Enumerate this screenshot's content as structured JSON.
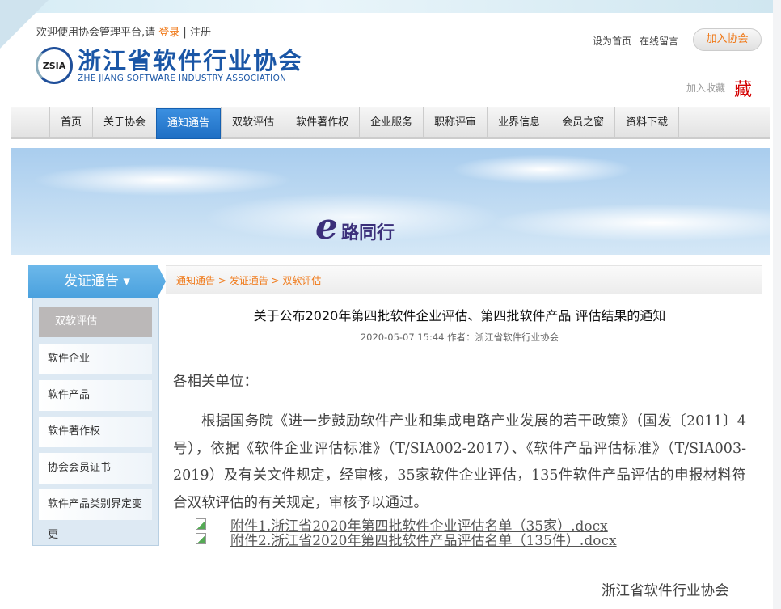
{
  "header": {
    "welcome": "欢迎使用协会管理平台,请 ",
    "login": "登录",
    "sep": " | ",
    "register": "注册",
    "logo_badge": "ZSIA",
    "logo_cn": "浙江省软件行业协会",
    "logo_en": "ZHE JIANG SOFTWARE INDUSTRY ASSOCIATION",
    "set_home": "设为首页",
    "message": "在线留言",
    "join": "加入协会",
    "favorite": "加入收藏",
    "favorite_icon": "藏"
  },
  "nav": [
    "首页",
    "关于协会",
    "通知通告",
    "双软评估",
    "软件著作权",
    "企业服务",
    "职称评审",
    "业界信息",
    "会员之窗",
    "资料下载"
  ],
  "banner": {
    "e": "e",
    "text": "路同行"
  },
  "sidebar": {
    "title": "发证通告 ▾",
    "items": [
      "双软评估",
      "软件企业",
      "软件产品",
      "软件著作权",
      "协会会员证书",
      "软件产品类别界定变更"
    ]
  },
  "breadcrumb": {
    "items": [
      "通知通告",
      "发证通告",
      "双软评估"
    ],
    "sep": " > "
  },
  "article": {
    "title": "关于公布2020年第四批软件企业评估、第四批软件产品 评估结果的通知",
    "meta": "2020-05-07 15:44   作者：浙江省软件行业协会",
    "salutation": "各相关单位：",
    "paragraph": "根据国务院《进一步鼓励软件产业和集成电路产业发展的若干政策》（国发〔2011〕4号），依据《软件企业评估标准》（T/SIA002-2017）、《软件产品评估标准》（T/SIA003-2019）及有关文件规定，经审核，35家软件企业评估，135件软件产品评估的申报材料符合双软评估的有关规定，审核予以通过。",
    "attachments": [
      "附件1.浙江省2020年第四批软件企业评估名单（35家）.docx",
      "附件2.浙江省2020年第四批软件产品评估名单（135件）.docx"
    ],
    "signature": "浙江省软件行业协会"
  }
}
